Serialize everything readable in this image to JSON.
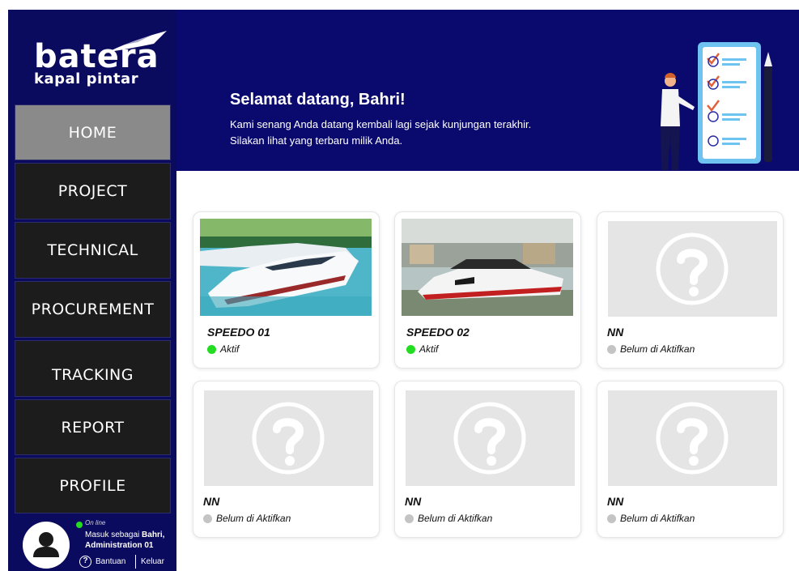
{
  "logo": {
    "brand": "batera",
    "tagline": "kapal pintar"
  },
  "nav": [
    {
      "label": "HOME",
      "active": true
    },
    {
      "label": "PROJECT",
      "active": false
    },
    {
      "label": "TECHNICAL",
      "active": false
    },
    {
      "label": "PROCUREMENT",
      "active": false
    },
    {
      "label": "TRACKING",
      "active": false
    },
    {
      "label": "REPORT",
      "active": false
    },
    {
      "label": "PROFILE",
      "active": false
    }
  ],
  "user": {
    "status": "On line",
    "login_prefix": "Masuk sebagai",
    "name": "Bahri,",
    "role": "Administration 01",
    "help": "Bantuan",
    "logout": "Keluar"
  },
  "header": {
    "title": "Selamat datang, Bahri!",
    "line1": "Kami senang Anda datang kembali lagi sejak kunjungan terakhir.",
    "line2": "Silakan lihat yang terbaru milik Anda."
  },
  "colors": {
    "active_status": "#22dd22",
    "inactive_status": "#c4c4c4",
    "sidebar": "#0a0a5e",
    "header": "#0a0a6e"
  },
  "cards": [
    {
      "name": "SPEEDO 01",
      "status": "Aktif",
      "image": "speedboat-photo"
    },
    {
      "name": "SPEEDO 02",
      "status": "Aktif",
      "image": "speedboat-photo"
    },
    {
      "name": "NN",
      "status": "Belum di Aktifkan",
      "image": "question-placeholder"
    },
    {
      "name": "NN",
      "status": "Belum di Aktifkan",
      "image": "question-placeholder"
    },
    {
      "name": "NN",
      "status": "Belum di Aktifkan",
      "image": "question-placeholder"
    },
    {
      "name": "NN",
      "status": "Belum di Aktifkan",
      "image": "question-placeholder"
    }
  ]
}
